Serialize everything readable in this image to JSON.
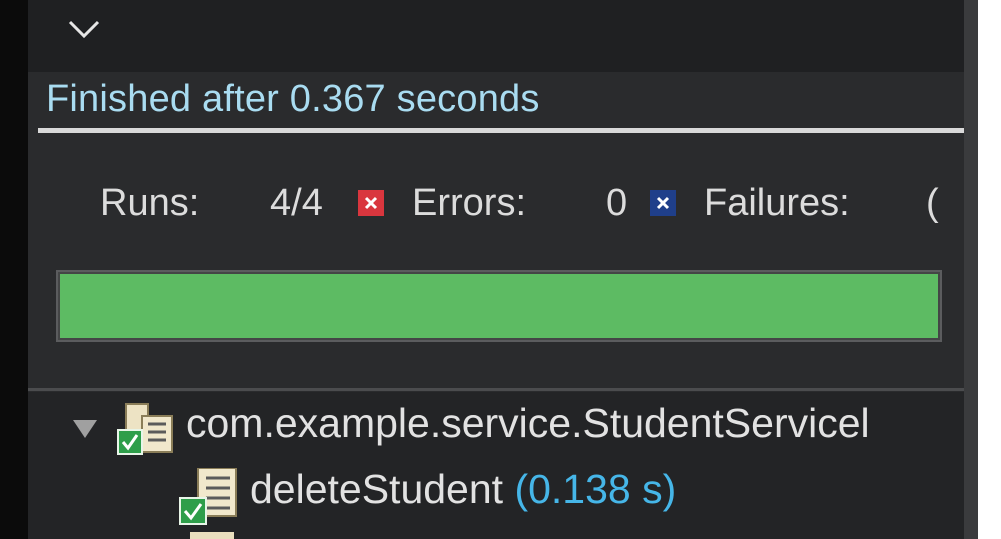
{
  "status": {
    "text": "Finished after 0.367 seconds"
  },
  "counts": {
    "runs_label": "Runs:",
    "runs_value": "4/4",
    "errors_label": "Errors:",
    "errors_value": "0",
    "failures_label": "Failures:",
    "failures_value": "("
  },
  "progress": {
    "fraction": 1.0,
    "color": "#5dbb63"
  },
  "tree": {
    "suite": {
      "name": "com.example.service.StudentServicel"
    },
    "tests": [
      {
        "name": "deleteStudent",
        "time": "(0.138 s)"
      }
    ]
  },
  "icons": {
    "collapse": "chevron-down-icon",
    "error_badge": "error-x-icon",
    "failure_badge": "failure-x-icon",
    "expand": "triangle-down-icon",
    "suite": "test-suite-pass-icon",
    "test": "test-pass-icon"
  },
  "colors": {
    "panel_bg": "#2a2b2d",
    "status_text": "#a9dcf1",
    "error_red": "#d9363e",
    "failure_blue": "#1f3f8a",
    "pass_green": "#5dbb63",
    "time_blue": "#46b6e8"
  }
}
